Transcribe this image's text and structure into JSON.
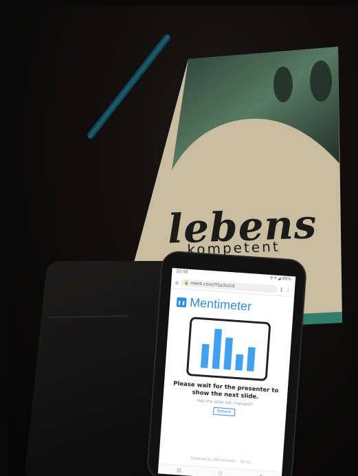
{
  "brochure": {
    "title_script": "lebens",
    "title_sub": "kompetent"
  },
  "phone": {
    "status_time": "20:58",
    "status_icons": "⚲ ▾ ◢ 88%",
    "url": "menti.com/?f1p3s1li5",
    "tab_count": "1",
    "brand_name": "Mentimeter",
    "wait_message": "Please wait for the presenter to show the next slide.",
    "sub_message": "Has the slide not changed?",
    "refresh_label": "Refresh",
    "footer_powered": "Powered by Mentimeter",
    "footer_terms": "Terms",
    "nav_icons": [
      "|||",
      "○",
      "<"
    ]
  },
  "colors": {
    "brand": "#2d8ee8",
    "bar": "#3ea1f2"
  },
  "chart_data": {
    "type": "bar",
    "values": [
      3,
      5,
      4,
      2,
      3
    ]
  }
}
